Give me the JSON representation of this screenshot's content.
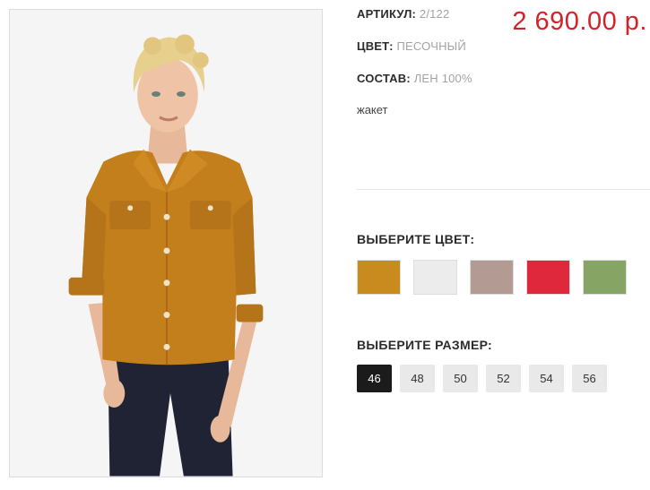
{
  "product": {
    "article_label": "АРТИКУЛ:",
    "article_value": "2/122",
    "color_label": "ЦВЕТ:",
    "color_value": "ПЕСОЧНЫЙ",
    "composition_label": "СОСТАВ:",
    "composition_value": "ЛЕН 100%",
    "description": "жакет",
    "price": "2 690.00 р."
  },
  "color_picker": {
    "heading": "ВЫБЕРИТЕ ЦВЕТ:",
    "swatches": [
      {
        "color": "#c98a1e"
      },
      {
        "color": "#ececec"
      },
      {
        "color": "#b39a93"
      },
      {
        "color": "#e0283c"
      },
      {
        "color": "#86a463"
      }
    ]
  },
  "size_picker": {
    "heading": "ВЫБЕРИТЕ РАЗМЕР:",
    "sizes": [
      "46",
      "48",
      "50",
      "52",
      "54",
      "56"
    ],
    "selected": "46"
  },
  "colors": {
    "price": "#d2232a",
    "garment": "#c27f1c",
    "selected_size_bg": "#1b1b1b"
  }
}
